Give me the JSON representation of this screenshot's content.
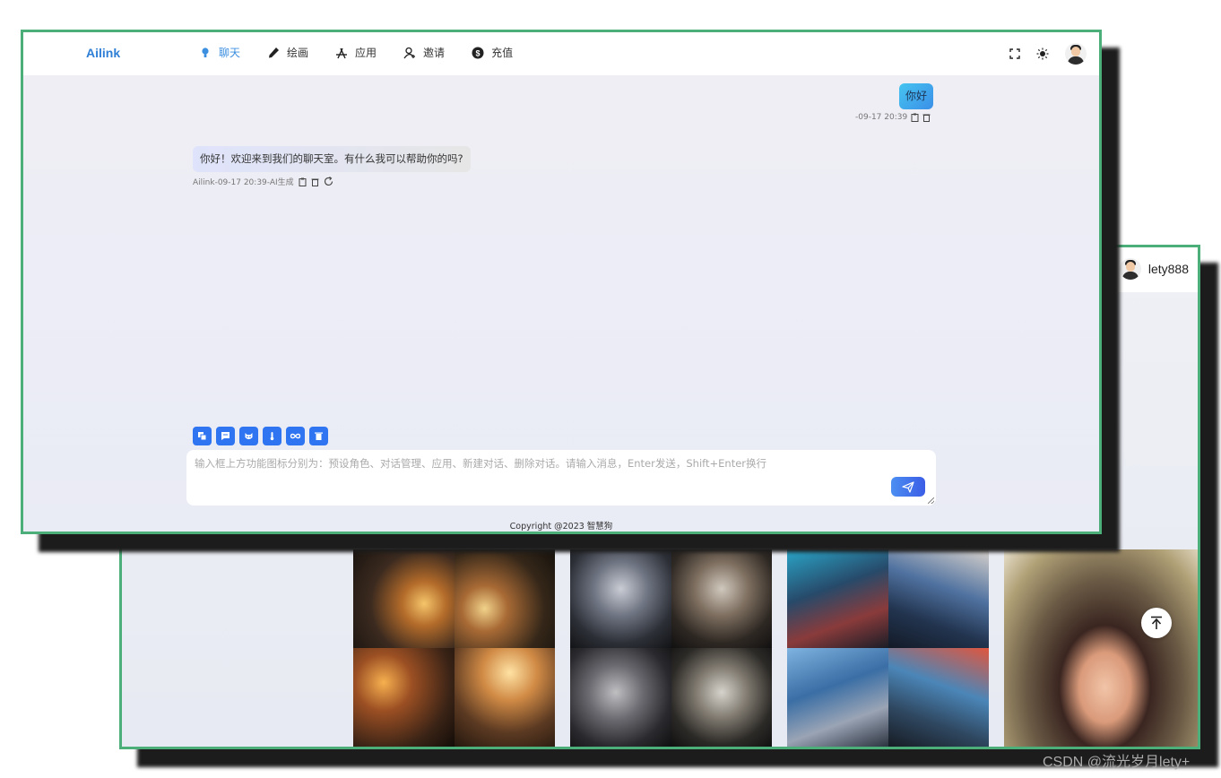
{
  "back_window": {
    "username": "lety888",
    "gallery": [
      {
        "name": "sunset-hat-woman-grid"
      },
      {
        "name": "elder-warrior-grid"
      },
      {
        "name": "blue-hair-cyber-grid"
      },
      {
        "name": "girl-portrait-blossoms"
      }
    ]
  },
  "front_window": {
    "logo": "Ailink",
    "nav": [
      {
        "label": "聊天",
        "icon": "lightbulb-icon",
        "active": true
      },
      {
        "label": "绘画",
        "icon": "pencil-icon",
        "active": false
      },
      {
        "label": "应用",
        "icon": "app-store-icon",
        "active": false
      },
      {
        "label": "邀请",
        "icon": "invite-user-icon",
        "active": false
      },
      {
        "label": "充值",
        "icon": "dollar-icon",
        "active": false
      }
    ],
    "header_icons": [
      "fullscreen-icon",
      "sun-icon",
      "avatar"
    ],
    "messages": {
      "user": {
        "text": "你好",
        "time": "-09-17 20:39"
      },
      "ai": {
        "text": "你好！欢迎来到我们的聊天室。有什么我可以帮助你的吗?",
        "meta": "Ailink-09-17 20:39-AI生成"
      }
    },
    "toolbar": [
      "preset-role-icon",
      "conversation-manage-icon",
      "apps-icon",
      "new-conversation-icon",
      "infinity-icon",
      "delete-conversation-icon"
    ],
    "input": {
      "placeholder": "输入框上方功能图标分别为：预设角色、对话管理、应用、新建对话、删除对话。请输入消息，Enter发送，Shift+Enter换行",
      "value": ""
    },
    "copyright": "Copyright @2023 智慧狗"
  },
  "watermark": "CSDN @流光岁月lety+",
  "colors": {
    "accent": "#2f74f0",
    "frame_border": "#4caf7a",
    "logo": "#2f7fd6"
  }
}
